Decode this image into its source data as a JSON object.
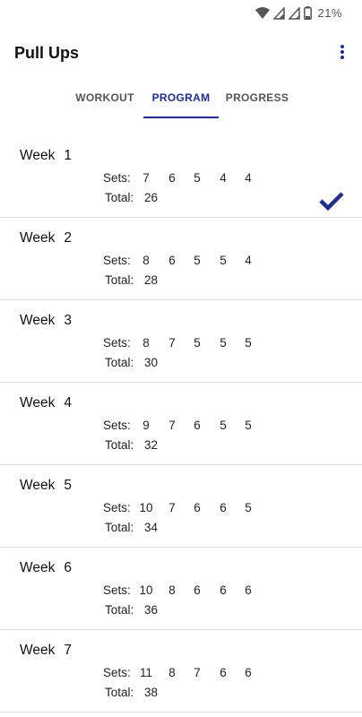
{
  "status_bar": {
    "battery_percent": "21%",
    "icons": [
      "wifi-icon",
      "signal-icon",
      "signal-icon",
      "battery-icon"
    ]
  },
  "app_bar": {
    "title": "Pull Ups",
    "menu_icon": "overflow-menu-icon"
  },
  "tabs": [
    {
      "label": "WORKOUT",
      "active": false
    },
    {
      "label": "PROGRAM",
      "active": true
    },
    {
      "label": "PROGRESS",
      "active": false
    }
  ],
  "labels": {
    "week": "Week",
    "sets": "Sets:",
    "total": "Total:"
  },
  "weeks": [
    {
      "number": "1",
      "sets": [
        "7",
        "6",
        "5",
        "4",
        "4"
      ],
      "total": "26",
      "completed": true
    },
    {
      "number": "2",
      "sets": [
        "8",
        "6",
        "5",
        "5",
        "4"
      ],
      "total": "28",
      "completed": false
    },
    {
      "number": "3",
      "sets": [
        "8",
        "7",
        "5",
        "5",
        "5"
      ],
      "total": "30",
      "completed": false
    },
    {
      "number": "4",
      "sets": [
        "9",
        "7",
        "6",
        "5",
        "5"
      ],
      "total": "32",
      "completed": false
    },
    {
      "number": "5",
      "sets": [
        "10",
        "7",
        "6",
        "6",
        "5"
      ],
      "total": "34",
      "completed": false
    },
    {
      "number": "6",
      "sets": [
        "10",
        "8",
        "6",
        "6",
        "6"
      ],
      "total": "36",
      "completed": false
    },
    {
      "number": "7",
      "sets": [
        "11",
        "8",
        "7",
        "6",
        "6"
      ],
      "total": "38",
      "completed": false
    }
  ],
  "colors": {
    "accent": "#1f2d8f",
    "divider": "#dcdcdc",
    "text": "#111111"
  }
}
